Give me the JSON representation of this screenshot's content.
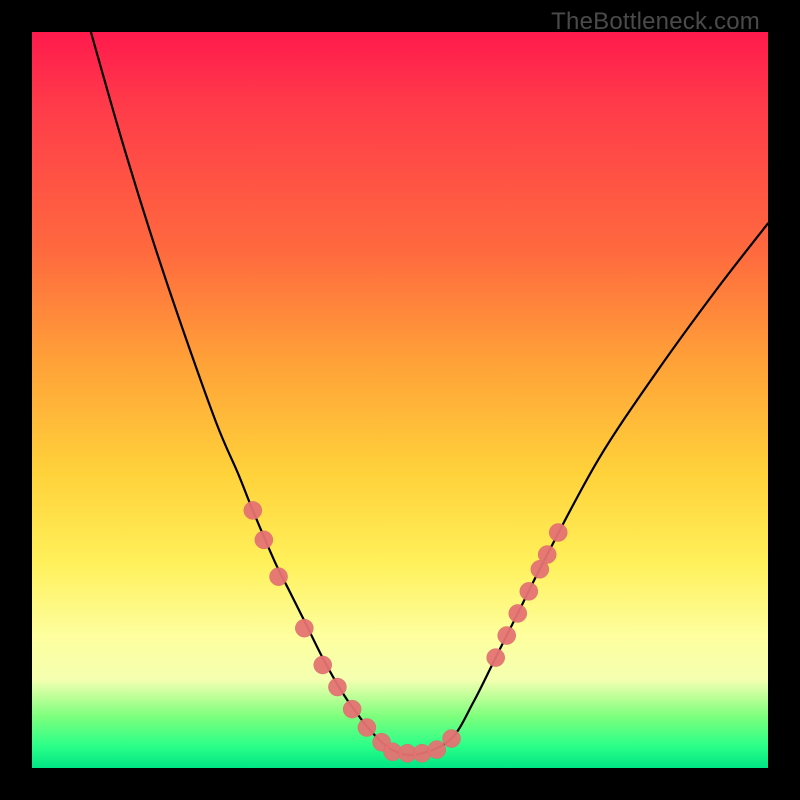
{
  "watermark": "TheBottleneck.com",
  "chart_data": {
    "type": "line",
    "title": "",
    "xlabel": "",
    "ylabel": "",
    "xlim": [
      0,
      100
    ],
    "ylim": [
      0,
      100
    ],
    "grid": false,
    "series": [
      {
        "name": "curve",
        "x": [
          8,
          12,
          16,
          20,
          25,
          28,
          30,
          33,
          35,
          37,
          40,
          43,
          47,
          50,
          53,
          57,
          60,
          63,
          66,
          70,
          77,
          85,
          93,
          100
        ],
        "y": [
          100,
          86,
          73,
          61,
          47,
          40,
          35,
          28,
          24,
          20,
          14,
          9,
          4,
          2,
          2,
          4,
          9,
          15,
          21,
          29,
          42,
          54,
          65,
          74
        ]
      }
    ],
    "markers": [
      {
        "x": 30.0,
        "y": 35
      },
      {
        "x": 31.5,
        "y": 31
      },
      {
        "x": 33.5,
        "y": 26
      },
      {
        "x": 37.0,
        "y": 19
      },
      {
        "x": 39.5,
        "y": 14
      },
      {
        "x": 41.5,
        "y": 11
      },
      {
        "x": 43.5,
        "y": 8
      },
      {
        "x": 45.5,
        "y": 5.5
      },
      {
        "x": 47.5,
        "y": 3.5
      },
      {
        "x": 49.0,
        "y": 2.2
      },
      {
        "x": 51.0,
        "y": 2.0
      },
      {
        "x": 53.0,
        "y": 2.0
      },
      {
        "x": 55.0,
        "y": 2.5
      },
      {
        "x": 57.0,
        "y": 4.0
      },
      {
        "x": 63.0,
        "y": 15
      },
      {
        "x": 64.5,
        "y": 18
      },
      {
        "x": 66.0,
        "y": 21
      },
      {
        "x": 67.5,
        "y": 24
      },
      {
        "x": 69.0,
        "y": 27
      },
      {
        "x": 70.0,
        "y": 29
      },
      {
        "x": 71.5,
        "y": 32
      }
    ],
    "marker_color": "#e57373",
    "background_gradient": {
      "top": "#ff1a4d",
      "bottom": "#00e584"
    }
  }
}
